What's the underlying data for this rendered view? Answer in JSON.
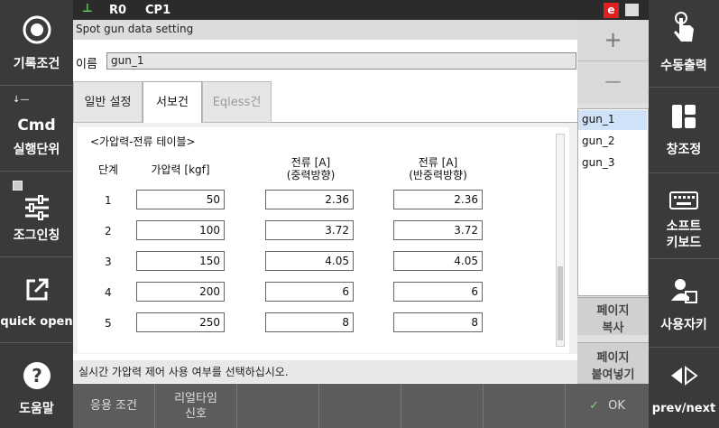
{
  "status_bar": {
    "robot": "R0",
    "program": "CP1",
    "e_badge": "e"
  },
  "window": {
    "title": "Spot gun data setting"
  },
  "name_field": {
    "label": "이름",
    "value": "gun_1"
  },
  "tabs": [
    {
      "label": "일반 설정"
    },
    {
      "label": "서보건"
    },
    {
      "label": "Eqless건"
    }
  ],
  "table": {
    "title": "<가압력-전류 테이블>",
    "headers": {
      "step": "단계",
      "force": "가압력 [kgf]",
      "current_fwd_1": "전류 [A]",
      "current_fwd_2": "(중력방향)",
      "current_rev_1": "전류 [A]",
      "current_rev_2": "(반중력방향)"
    },
    "rows": [
      {
        "step": "1",
        "force": "50",
        "cur_g": "2.36",
        "cur_ag": "2.36"
      },
      {
        "step": "2",
        "force": "100",
        "cur_g": "3.72",
        "cur_ag": "3.72"
      },
      {
        "step": "3",
        "force": "150",
        "cur_g": "4.05",
        "cur_ag": "4.05"
      },
      {
        "step": "4",
        "force": "200",
        "cur_g": "6",
        "cur_ag": "6"
      },
      {
        "step": "5",
        "force": "250",
        "cur_g": "8",
        "cur_ag": "8"
      }
    ]
  },
  "message": "실시간 가압력 제어 사용 여부를 선택하십시오.",
  "bottom_bar": {
    "btn1": "응용 조건",
    "btn2_line1": "리얼타임",
    "btn2_line2": "신호",
    "ok": "OK"
  },
  "gun_list": [
    "gun_1",
    "gun_2",
    "gun_3"
  ],
  "right_inner": {
    "plus": "+",
    "minus": "—",
    "page_copy_1": "페이지",
    "page_copy_2": "복사",
    "page_paste_1": "페이지",
    "page_paste_2": "붙여넣기"
  },
  "left_menu": {
    "record": "기록조건",
    "cmd": "Cmd",
    "exec_unit": "실행단위",
    "jog": "조그인칭",
    "quick_open": "quick open",
    "help": "도움말"
  },
  "right_menu": {
    "manual_out": "수동출력",
    "window_arrange": "창조정",
    "soft_kb_1": "소프트",
    "soft_kb_2": "키보드",
    "user_key": "사용자키",
    "prev_next": "prev/next"
  }
}
